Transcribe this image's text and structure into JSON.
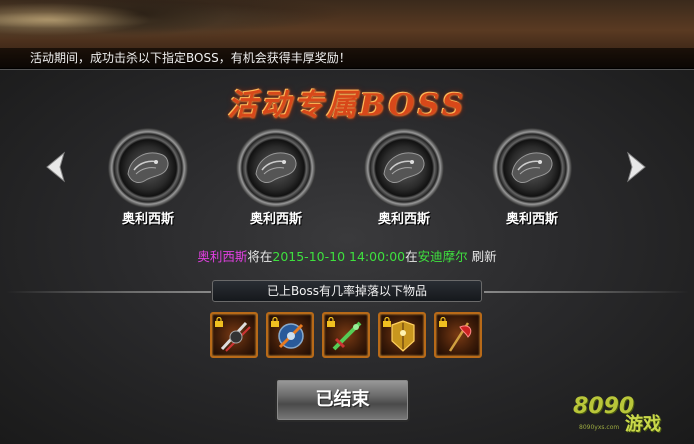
{
  "banner": {
    "notice": "活动期间，成功击杀以下指定BOSS，有机会获得丰厚奖励！"
  },
  "title": "活动专属BOSS",
  "bosses": [
    {
      "name": "奥利西斯",
      "icon": "dragon-head-icon"
    },
    {
      "name": "奥利西斯",
      "icon": "dragon-head-icon"
    },
    {
      "name": "奥利西斯",
      "icon": "dragon-head-icon"
    },
    {
      "name": "奥利西斯",
      "icon": "dragon-head-icon"
    }
  ],
  "info": {
    "boss": "奥利西斯",
    "will_at": "将在",
    "time": "2015-10-10 14:00:00",
    "at": "在",
    "location": "安迪摩尔",
    "refresh": " 刷新"
  },
  "drops": {
    "header": "已上Boss有几率掉落以下物品",
    "items": [
      {
        "icon": "weapon-blades-icon"
      },
      {
        "icon": "orb-weapon-icon"
      },
      {
        "icon": "green-blade-icon"
      },
      {
        "icon": "gold-armor-icon"
      },
      {
        "icon": "red-axe-icon"
      }
    ]
  },
  "end_button": "已结束",
  "logo": {
    "number": "8090",
    "text": "游戏",
    "url": "8090yxs.com"
  },
  "colors": {
    "title": "#d8481a",
    "pink": "#e040e0",
    "green": "#3ee03e",
    "item_border": "#b86a18"
  }
}
